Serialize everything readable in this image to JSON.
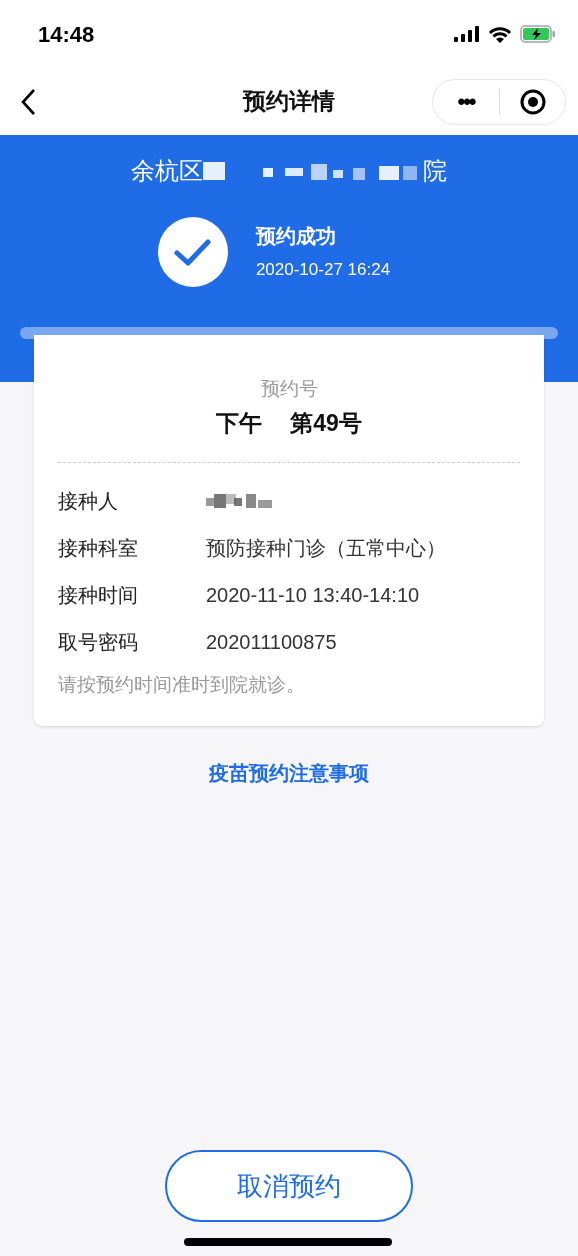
{
  "status_bar": {
    "time": "14:48"
  },
  "nav": {
    "title": "预约详情",
    "menu_glyph": "•••"
  },
  "header": {
    "hospital_prefix": "余杭区",
    "hospital_suffix": "院",
    "status": "预约成功",
    "time": "2020-10-27 16:24"
  },
  "card": {
    "number_label": "预约号",
    "period": "下午",
    "number": "第49号",
    "rows": [
      {
        "label": "接种人",
        "kind": "redacted"
      },
      {
        "label": "接种科室",
        "kind": "text",
        "value": "预防接种门诊（五常中心）"
      },
      {
        "label": "接种时间",
        "kind": "text",
        "value": "2020-11-10 13:40-14:10"
      },
      {
        "label": "取号密码",
        "kind": "text",
        "value": "202011100875"
      }
    ],
    "note": "请按预约时间准时到院就诊。"
  },
  "notice_link": "疫苗预约注意事项",
  "cancel_button": "取消预约"
}
